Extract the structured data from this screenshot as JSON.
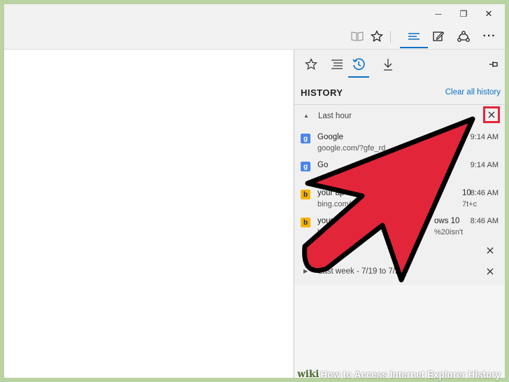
{
  "window_controls": {
    "minimize": "—",
    "restore": "❐",
    "close": "✕"
  },
  "toolbar": {
    "reading_view_icon": "book-icon",
    "favorite_icon": "star-icon",
    "hub_icon": "hub-lines-icon",
    "note_icon": "pen-icon",
    "share_icon": "share-icon",
    "more_label": "···"
  },
  "panel": {
    "title": "HISTORY",
    "clear_all": "Clear all history",
    "pin_icon": "pin-icon",
    "tabs": [
      "favorites",
      "reading-list",
      "history",
      "downloads"
    ],
    "groups": {
      "last_hour": "Last hour",
      "group2_label": "",
      "last_week": "Last week - 7/19 to 7/2"
    },
    "items": [
      {
        "title": "Google",
        "url": "google.com/?gfe_rd",
        "time": "9:14 AM",
        "favicon": "g"
      },
      {
        "title": "Go",
        "url": "",
        "time": "9:14 AM",
        "favicon": "g"
      },
      {
        "title": "your ap",
        "url": "bing.com/s",
        "time": "8:46 AM",
        "favicon": "b",
        "title_tail": "10",
        "url_tail": "7t+c"
      },
      {
        "title": "your",
        "url": "bi",
        "time": "8:46 AM",
        "favicon": "b",
        "title_tail": "ows 10",
        "url_tail": "%20isn't"
      }
    ]
  },
  "accent_color": "#0a72c7",
  "arrow_color": "#e3253a",
  "footer": {
    "wiki": "wiki",
    "caption": "How to Access Internet Explorer History"
  }
}
